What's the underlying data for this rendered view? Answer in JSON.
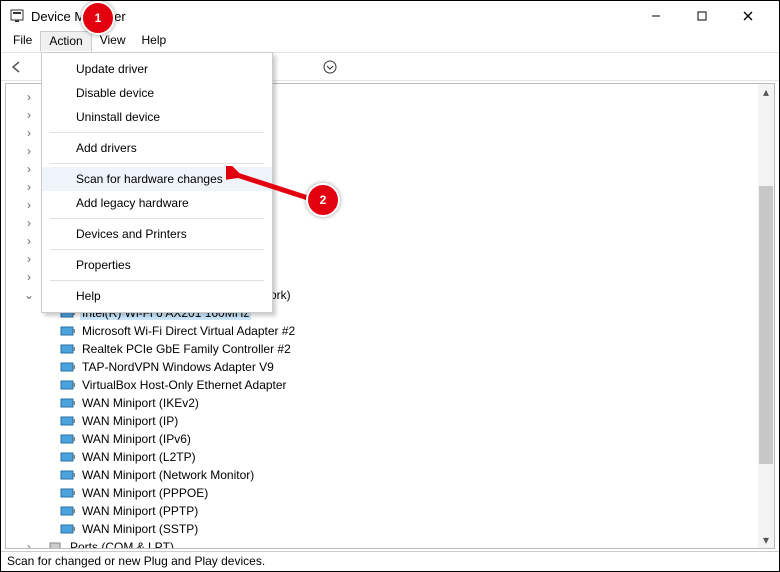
{
  "window": {
    "title": "Device Manager"
  },
  "menubar": {
    "items": [
      "File",
      "Action",
      "View",
      "Help"
    ],
    "open_index": 1
  },
  "dropdown": {
    "items": [
      {
        "label": "Update driver"
      },
      {
        "label": "Disable device"
      },
      {
        "label": "Uninstall device"
      },
      {
        "sep": true
      },
      {
        "label": "Add drivers"
      },
      {
        "sep": true
      },
      {
        "label": "Scan for hardware changes",
        "hover": true
      },
      {
        "label": "Add legacy hardware"
      },
      {
        "sep": true
      },
      {
        "label": "Devices and Printers"
      },
      {
        "sep": true
      },
      {
        "label": "Properties"
      },
      {
        "sep": true
      },
      {
        "label": "Help"
      }
    ]
  },
  "tree": {
    "collapsed_placeholders": 11,
    "visible_partial_label": "twork)",
    "children": [
      {
        "label": "Intel(R) Wi-Fi 6 AX201 160MHz",
        "selected": true
      },
      {
        "label": "Microsoft Wi-Fi Direct Virtual Adapter #2"
      },
      {
        "label": "Realtek PCIe GbE Family Controller #2"
      },
      {
        "label": "TAP-NordVPN Windows Adapter V9"
      },
      {
        "label": "VirtualBox Host-Only Ethernet Adapter"
      },
      {
        "label": "WAN Miniport (IKEv2)"
      },
      {
        "label": "WAN Miniport (IP)"
      },
      {
        "label": "WAN Miniport (IPv6)"
      },
      {
        "label": "WAN Miniport (L2TP)"
      },
      {
        "label": "WAN Miniport (Network Monitor)"
      },
      {
        "label": "WAN Miniport (PPPOE)"
      },
      {
        "label": "WAN Miniport (PPTP)"
      },
      {
        "label": "WAN Miniport (SSTP)"
      }
    ],
    "next_collapsed_label": "Ports (COM & LPT)"
  },
  "statusbar": {
    "text": "Scan for changed or new Plug and Play devices."
  },
  "callouts": {
    "c1": "1",
    "c2": "2"
  }
}
